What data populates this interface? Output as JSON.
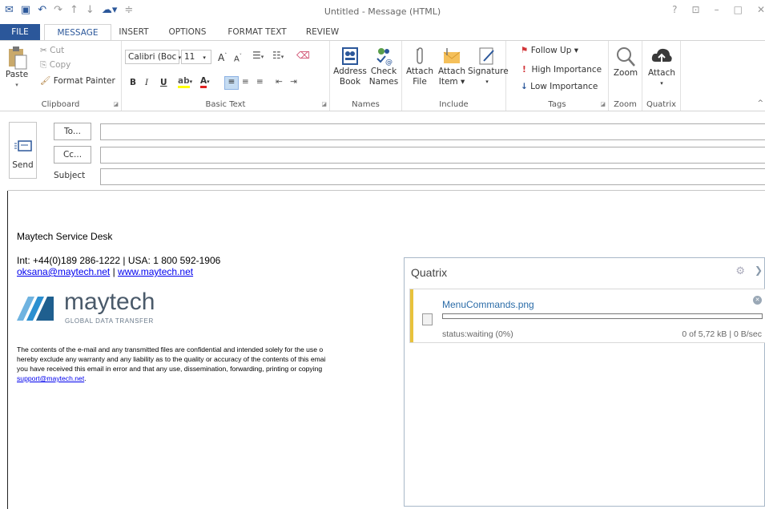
{
  "window": {
    "title": "Untitled - Message (HTML)",
    "controls": [
      "?",
      "⊡",
      "–",
      "□",
      "✕"
    ]
  },
  "tabs": [
    {
      "label": "FILE"
    },
    {
      "label": "MESSAGE"
    },
    {
      "label": "INSERT"
    },
    {
      "label": "OPTIONS"
    },
    {
      "label": "FORMAT TEXT"
    },
    {
      "label": "REVIEW"
    }
  ],
  "ribbon": {
    "clipboard": {
      "label": "Clipboard",
      "paste": "Paste",
      "cut": "Cut",
      "copy": "Copy",
      "format_painter": "Format Painter"
    },
    "basic_text": {
      "label": "Basic Text",
      "font": "Calibri (Boc",
      "size": "11",
      "bold": "B",
      "italic": "I",
      "underline": "U"
    },
    "names": {
      "label": "Names",
      "address_book_1": "Address",
      "address_book_2": "Book",
      "check_names_1": "Check",
      "check_names_2": "Names"
    },
    "include": {
      "label": "Include",
      "attach_file_1": "Attach",
      "attach_file_2": "File",
      "attach_item_1": "Attach",
      "attach_item_2": "Item ▾",
      "signature": "Signature"
    },
    "tags": {
      "label": "Tags",
      "follow_up": "Follow Up ▾",
      "high_importance": "High Importance",
      "low_importance": "Low Importance"
    },
    "zoom": {
      "label": "Zoom",
      "button": "Zoom"
    },
    "quatrix": {
      "label": "Quatrix",
      "button": "Attach"
    }
  },
  "compose": {
    "send": "Send",
    "to": "To...",
    "cc": "Cc...",
    "subject": "Subject"
  },
  "signature": {
    "name": "Maytech Service Desk",
    "phone": "Int: +44(0)189 286-1222 | USA: 1 800 592-1906",
    "email": "oksana@maytech.net",
    "separator": " | ",
    "website": "www.maytech.net",
    "logo_word": "maytech",
    "logo_tagline": "GLOBAL DATA TRANSFER"
  },
  "disclaimer": {
    "line1": "The contents of the e-mail and any transmitted files are confidential and intended solely for the use o",
    "line2": "hereby exclude any warranty and any liability as to the quality or accuracy of the contents of this emai",
    "line3": "you have received this email in error and that any use, dissemination, forwarding, printing or copying",
    "link": "support@maytech.net",
    "tail": "."
  },
  "quatrix_pane": {
    "title": "Quatrix",
    "file_name": "MenuCommands.png",
    "status": "status:waiting (0%)",
    "size_info": "0 of 5,72 kB | 0 B/sec",
    "progress": 0
  },
  "colors": {
    "accent": "#2b579a",
    "link": "#0000ee",
    "upload_bar": "#e8c23c",
    "follow_up_flag": "#d13438",
    "high_importance": "#d13438",
    "low_importance": "#2b579a"
  }
}
